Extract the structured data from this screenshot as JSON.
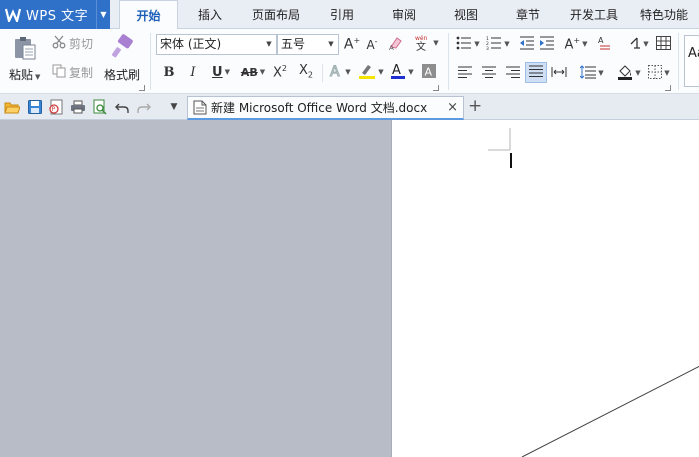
{
  "app": {
    "title": "WPS 文字",
    "logo": "W"
  },
  "tabs": [
    {
      "label": "开始",
      "active": true
    },
    {
      "label": "插入"
    },
    {
      "label": "页面布局"
    },
    {
      "label": "引用"
    },
    {
      "label": "审阅"
    },
    {
      "label": "视图"
    },
    {
      "label": "章节"
    },
    {
      "label": "开发工具"
    },
    {
      "label": "特色功能"
    }
  ],
  "clipboard": {
    "paste_label": "粘贴",
    "cut_label": "剪切",
    "copy_label": "复制",
    "format_painter_label": "格式刷"
  },
  "font": {
    "family": "宋体 (正文)",
    "size": "五号"
  },
  "style_preview": "Aa",
  "document": {
    "tab_name": "新建 Microsoft Office Word 文档.docx"
  },
  "colors": {
    "accent": "#2f71c9",
    "highlight": "#f5e400",
    "font_color": "#1f2fd0"
  }
}
